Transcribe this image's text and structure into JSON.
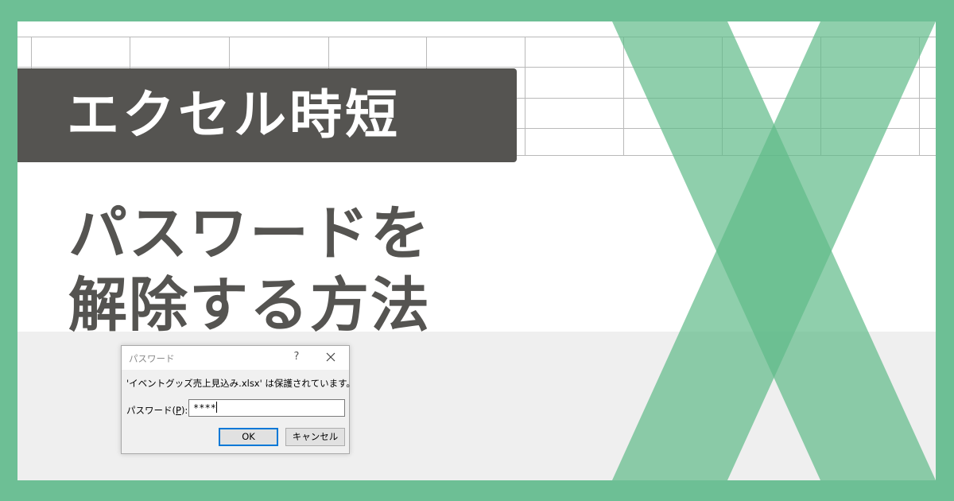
{
  "banner": {
    "text": "エクセル時短"
  },
  "headline": {
    "line1": "パスワードを",
    "line2": "解除する方法"
  },
  "dialog": {
    "title": "パスワード",
    "help_glyph": "?",
    "message": "'イベントグッズ売上見込み.xlsx' は保護されています。",
    "password_label_prefix": "パスワード(",
    "password_label_hotkey": "P",
    "password_label_suffix": "):",
    "password_value": "****",
    "ok_label": "OK",
    "cancel_label": "キャンセル"
  },
  "icons": {
    "logo": "excel-x-logo-icon",
    "close": "close-icon",
    "help": "help-icon"
  },
  "colors": {
    "frame": "#6dbf95",
    "banner_bg": "#555451",
    "headline_text": "#555451",
    "logo_green": "#60bb89",
    "ok_focus": "#0078d7"
  }
}
